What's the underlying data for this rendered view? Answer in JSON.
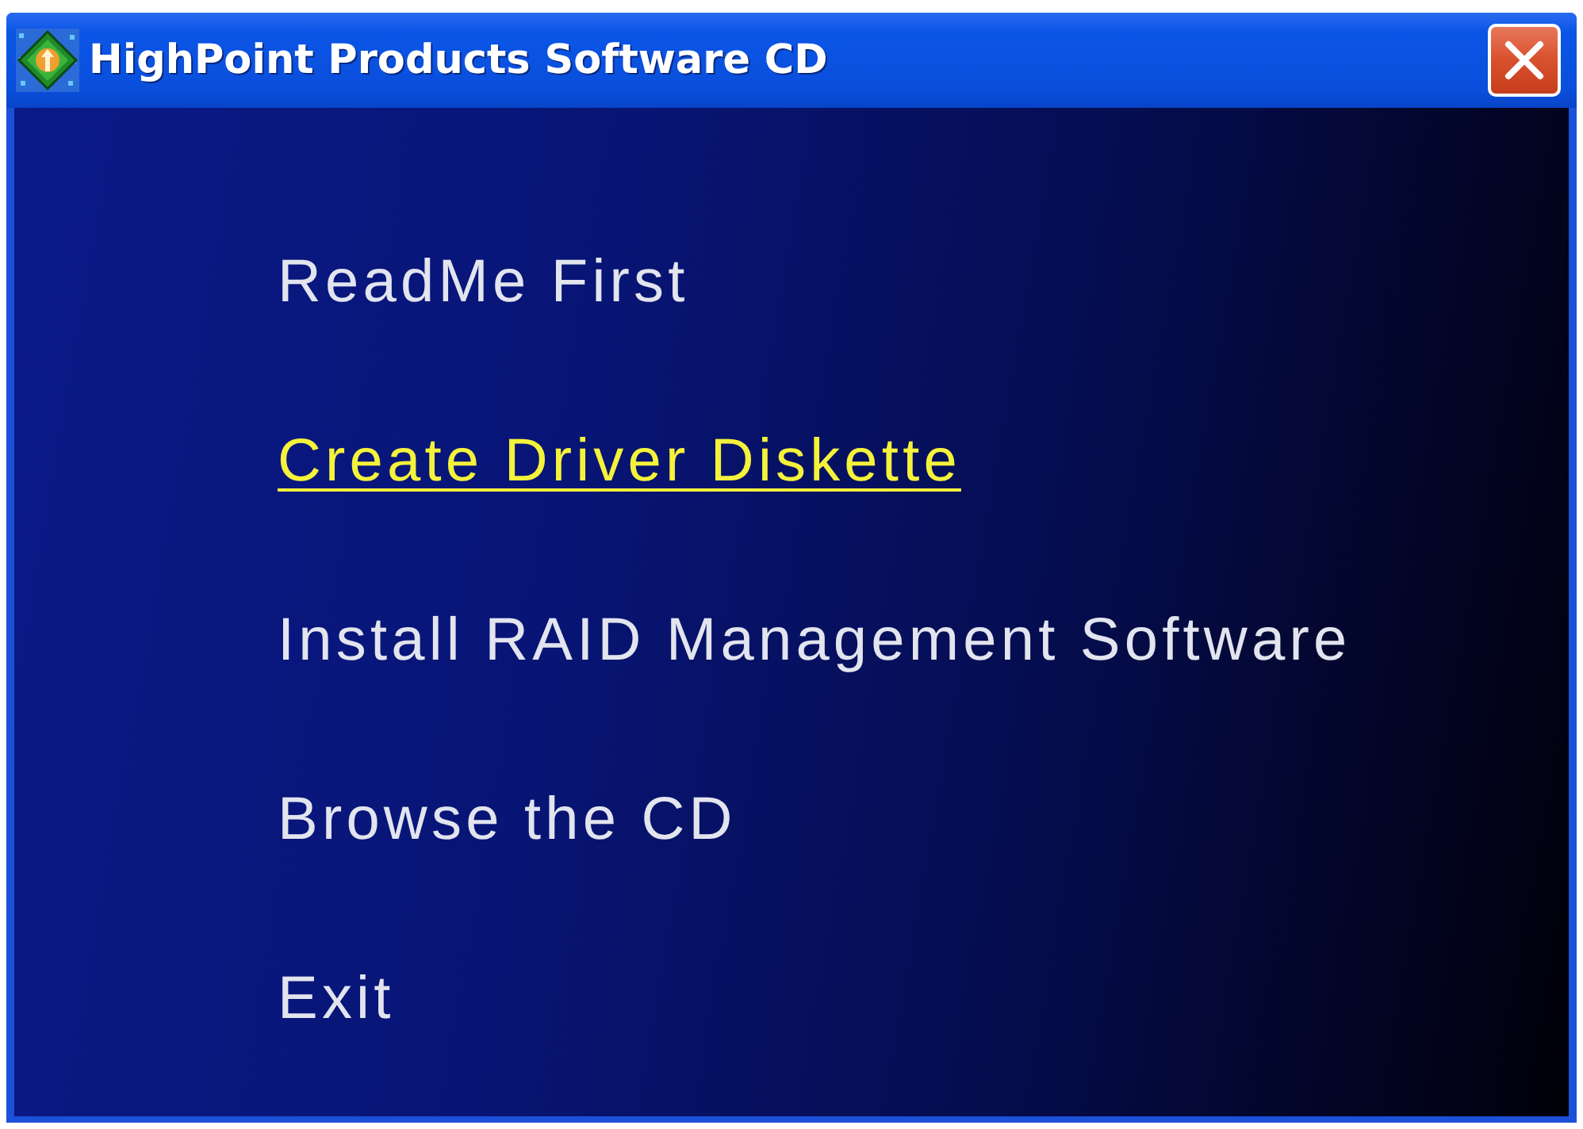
{
  "window": {
    "title": "HighPoint Products Software CD"
  },
  "menu": [
    {
      "label": "ReadMe First",
      "selected": false
    },
    {
      "label": "Create Driver Diskette",
      "selected": true
    },
    {
      "label": "Install RAID Management Software",
      "selected": false
    },
    {
      "label": "Browse the CD",
      "selected": false
    },
    {
      "label": "Exit",
      "selected": false
    }
  ]
}
